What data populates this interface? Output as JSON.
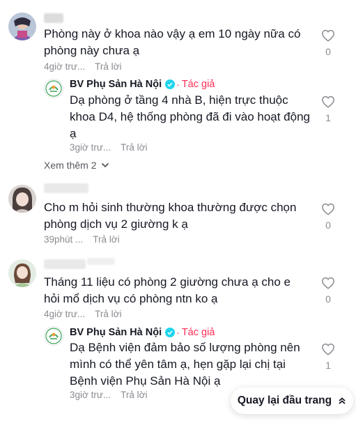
{
  "comments": [
    {
      "text": "Phòng này ở khoa nào vậy ạ em 10 ngày nữa có phòng này chưa ạ",
      "time": "4giờ trư...",
      "reply_label": "Trả lời",
      "likes": "0",
      "more_replies": "Xem thêm 2",
      "replies": [
        {
          "name": "BV Phụ Sản Hà Nội",
          "badge": "Tác giả",
          "text": "Dạ phòng ở tầng 4 nhà B, hiện trực thuộc khoa D4, hệ thống phòng đã đi vào hoạt động ạ",
          "time": "3giờ trư...",
          "reply_label": "Trả lời",
          "likes": "1"
        }
      ]
    },
    {
      "text": "Cho m hỏi sinh thường khoa thường được chọn phòng dịch vụ 2 giường k ạ",
      "time": "39phút ...",
      "reply_label": "Trả lời",
      "likes": "0"
    },
    {
      "text": "Tháng 11 liệu có phòng 2 giường chưa ạ cho e hỏi mổ dịch vụ có phòng ntn ko ạ",
      "time": "4giờ trư...",
      "reply_label": "Trả lời",
      "likes": "0",
      "replies": [
        {
          "name": "BV Phụ Sản Hà Nội",
          "badge": "Tác giả",
          "text": "Dạ Bệnh viện đảm bảo số lượng phòng nên mình có thể yên tâm ạ, hẹn gặp lại chị tại Bệnh viện Phụ Sản Hà Nội ạ",
          "time": "3giờ trư...",
          "reply_label": "Trả lời",
          "likes": "1"
        }
      ]
    }
  ],
  "back_to_top": "Quay lại đầu trang",
  "colors": {
    "author": "#fe2c55",
    "verified": "#20d5ec",
    "muted": "#8a8b91"
  }
}
